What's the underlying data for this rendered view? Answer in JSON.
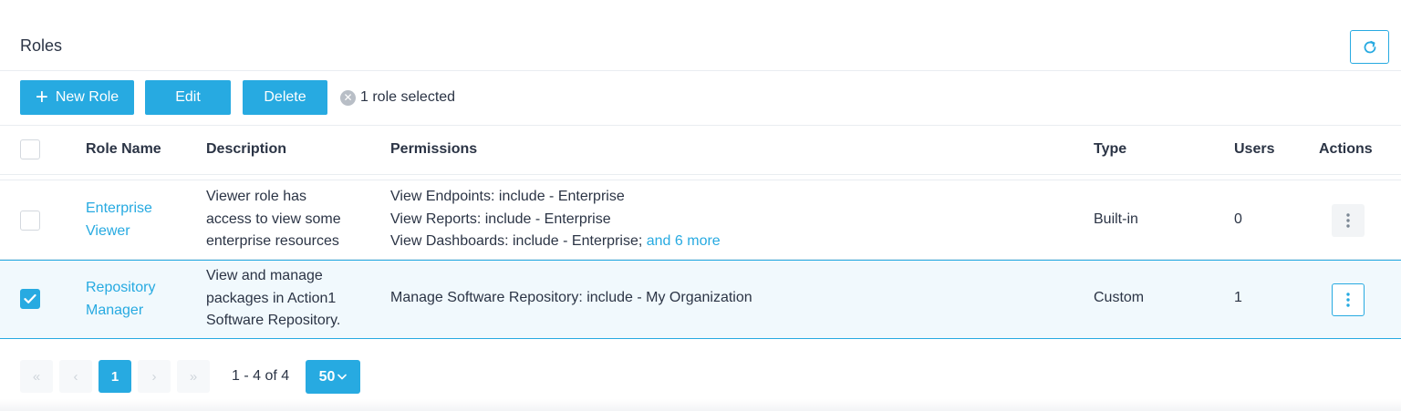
{
  "header": {
    "title": "Roles"
  },
  "toolbar": {
    "new_role_label": "New Role",
    "edit_label": "Edit",
    "delete_label": "Delete",
    "selection_text": "1 role selected"
  },
  "table": {
    "columns": [
      "Role Name",
      "Description",
      "Permissions",
      "Type",
      "Users",
      "Actions"
    ],
    "rows": [
      {
        "name_line1": "Enterprise",
        "name_line2": "Viewer",
        "desc_line1": "Viewer role has",
        "desc_line2": "access to view some",
        "desc_line3": "enterprise resources",
        "perm_line1": "View Endpoints: include - Enterprise",
        "perm_line2": "View Reports: include - Enterprise",
        "perm_line3": "View Dashboards: include - Enterprise;",
        "perm_more": "and 6 more",
        "type": "Built-in",
        "users": "0",
        "selected": false
      },
      {
        "name_line1": "Repository",
        "name_line2": "Manager",
        "desc_line1": "View and manage",
        "desc_line2": "packages in Action1",
        "desc_line3": "Software Repository.",
        "perm_line1": "Manage Software Repository: include - My Organization",
        "type": "Custom",
        "users": "1",
        "selected": true
      }
    ]
  },
  "pagination": {
    "first": "«",
    "prev": "‹",
    "current_page": "1",
    "next": "›",
    "last": "»",
    "range_text": "1 - 4 of 4",
    "page_size": "50"
  },
  "colors": {
    "accent": "#27aae1",
    "text": "#2b3445",
    "border": "#e9edf1",
    "selected_row": "#f1f9fd"
  },
  "icons": {
    "refresh": "refresh-icon",
    "plus": "plus-icon",
    "clear": "clear-selection-icon",
    "check": "check-icon",
    "more": "more-vertical-icon",
    "chevron": "chevron-down-icon"
  }
}
